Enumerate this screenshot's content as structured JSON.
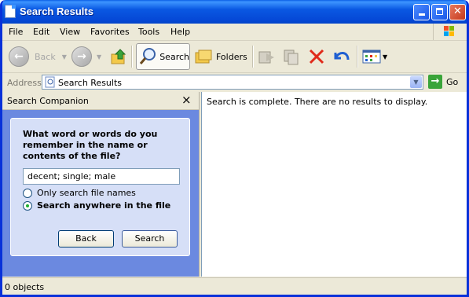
{
  "window": {
    "title": "Search Results"
  },
  "menu": [
    "File",
    "Edit",
    "View",
    "Favorites",
    "Tools",
    "Help"
  ],
  "toolbar": {
    "back_label": "Back",
    "search_label": "Search",
    "folders_label": "Folders"
  },
  "address": {
    "label": "Address",
    "value": "Search Results",
    "go_label": "Go"
  },
  "search_companion": {
    "title": "Search Companion",
    "question": "What word or words do you remember in the name or contents of the file?",
    "input_value": "decent; single; male",
    "options": [
      {
        "label": "Only search file names",
        "selected": false
      },
      {
        "label": "Search anywhere in the file",
        "selected": true
      }
    ],
    "back_button": "Back",
    "search_button": "Search"
  },
  "content": {
    "message": "Search is complete. There are no results to display."
  },
  "status": {
    "text": "0 objects"
  },
  "colors": {
    "titlebar": "#0548d6",
    "sidepane": "#6b89e0",
    "panel": "#d6dff7"
  }
}
